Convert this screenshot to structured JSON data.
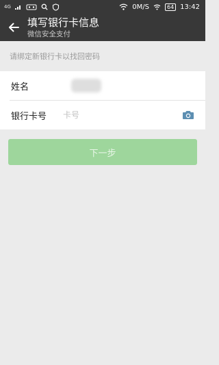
{
  "status_bar": {
    "network_label": "4G",
    "speed": "0M/S",
    "battery": "64",
    "time": "13:42"
  },
  "header": {
    "title": "填写银行卡信息",
    "subtitle": "微信安全支付"
  },
  "hint": "请绑定新银行卡以找回密码",
  "form": {
    "name_label": "姓名",
    "card_label": "银行卡号",
    "card_placeholder": "卡号"
  },
  "next_button": "下一步",
  "colors": {
    "bar": "#383838",
    "background": "#ebebeb",
    "button": "#9ed69c"
  }
}
